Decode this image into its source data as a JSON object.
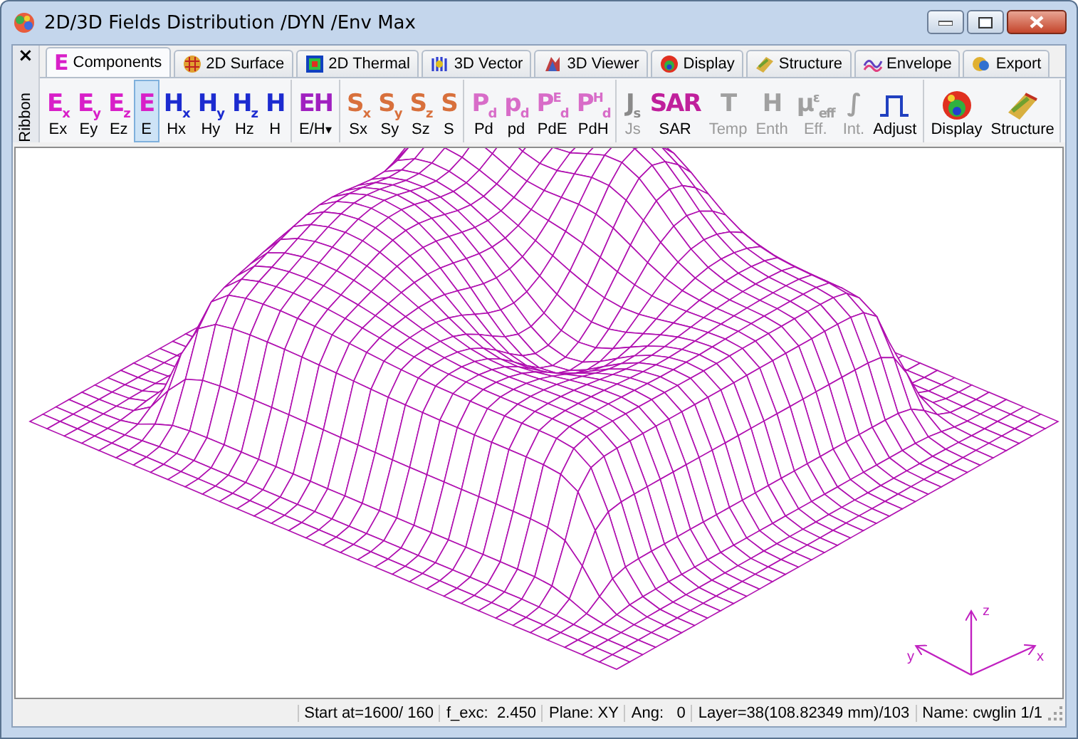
{
  "window": {
    "title": "2D/3D Fields Distribution /DYN /Env Max"
  },
  "ribbon_side": {
    "close": "×",
    "label": "Ribbon"
  },
  "tabs": [
    {
      "label": "Components",
      "glyph": "E",
      "kind": "glyph",
      "selected": true
    },
    {
      "label": "2D Surface",
      "kind": "surface",
      "selected": false
    },
    {
      "label": "2D Thermal",
      "kind": "thermal",
      "selected": false
    },
    {
      "label": "3D Vector",
      "kind": "vector",
      "selected": false
    },
    {
      "label": "3D Viewer",
      "kind": "viewer",
      "selected": false
    },
    {
      "label": "Display",
      "kind": "display",
      "selected": false
    },
    {
      "label": "Structure",
      "kind": "structure",
      "selected": false
    },
    {
      "label": "Envelope",
      "kind": "envelope",
      "selected": false
    },
    {
      "label": "Export",
      "kind": "export",
      "selected": false
    }
  ],
  "ribbon": {
    "groups": [
      [
        {
          "kind": "glyph",
          "glyph": "E$_{x}$",
          "label": "Ex",
          "color": "#d81fc8",
          "selected": false,
          "disabled": false
        },
        {
          "kind": "glyph",
          "glyph": "E$_{y}$",
          "label": "Ey",
          "color": "#d81fc8",
          "selected": false,
          "disabled": false
        },
        {
          "kind": "glyph",
          "glyph": "E$_{z}$",
          "label": "Ez",
          "color": "#d81fc8",
          "selected": false,
          "disabled": false
        },
        {
          "kind": "glyph",
          "glyph": "E",
          "label": "E",
          "color": "#d81fc8",
          "selected": true,
          "disabled": false
        },
        {
          "kind": "glyph",
          "glyph": "H$_{x}$",
          "label": "Hx",
          "color": "#1c2bd0",
          "selected": false,
          "disabled": false
        },
        {
          "kind": "glyph",
          "glyph": "H$_{y}$",
          "label": "Hy",
          "color": "#1c2bd0",
          "selected": false,
          "disabled": false
        },
        {
          "kind": "glyph",
          "glyph": "H$_{z}$",
          "label": "Hz",
          "color": "#1c2bd0",
          "selected": false,
          "disabled": false
        },
        {
          "kind": "glyph",
          "glyph": "H",
          "label": "H",
          "color": "#1c2bd0",
          "selected": false,
          "disabled": false
        }
      ],
      [
        {
          "kind": "dropdown",
          "glyph": "EH",
          "label": "E/H",
          "caret": "▾",
          "color": "#a020c0",
          "selected": false,
          "disabled": false
        }
      ],
      [
        {
          "kind": "glyph",
          "glyph": "S$_{x}$",
          "label": "Sx",
          "color": "#d8703c",
          "selected": false,
          "disabled": false
        },
        {
          "kind": "glyph",
          "glyph": "S$_{y}$",
          "label": "Sy",
          "color": "#d8703c",
          "selected": false,
          "disabled": false
        },
        {
          "kind": "glyph",
          "glyph": "S$_{z}$",
          "label": "Sz",
          "color": "#d8703c",
          "selected": false,
          "disabled": false
        },
        {
          "kind": "glyph",
          "glyph": "S",
          "label": "S",
          "color": "#d8703c",
          "selected": false,
          "disabled": false
        }
      ],
      [
        {
          "kind": "glyph",
          "glyph": "P$_{d}$",
          "label": "Pd",
          "color": "#d86cc8",
          "selected": false,
          "disabled": false
        },
        {
          "kind": "glyph",
          "glyph": "p$_{d}$",
          "label": "pd",
          "color": "#d86cc8",
          "selected": false,
          "disabled": false
        },
        {
          "kind": "glyph",
          "glyph": "P$^{E}$$_{d}$",
          "label": "PdE",
          "color": "#d86cc8",
          "selected": false,
          "disabled": false
        },
        {
          "kind": "glyph",
          "glyph": "P$^{H}$$_{d}$",
          "label": "PdH",
          "color": "#d86cc8",
          "selected": false,
          "disabled": false
        }
      ],
      [
        {
          "kind": "glyph",
          "glyph": "J$_{s}$",
          "label": "Js",
          "color": "#8a8a8a",
          "selected": false,
          "disabled": true
        },
        {
          "kind": "glyph",
          "glyph": "SAR",
          "label": "SAR",
          "color": "#c0209c",
          "selected": false,
          "disabled": false
        },
        {
          "kind": "glyph",
          "glyph": "T",
          "label": "Temp",
          "color": "#a0a0a0",
          "selected": false,
          "disabled": true
        },
        {
          "kind": "glyph",
          "glyph": "H",
          "label": "Enth",
          "color": "#a0a0a0",
          "selected": false,
          "disabled": true
        },
        {
          "kind": "glyph",
          "glyph": "μ$^{ε}$$_{eff}$",
          "label": "Eff.",
          "color": "#a0a0a0",
          "selected": false,
          "disabled": true
        },
        {
          "kind": "glyph",
          "glyph": "∫",
          "label": "Int.",
          "color": "#a0a0a0",
          "selected": false,
          "disabled": true
        },
        {
          "kind": "pulse",
          "label": "Adjust",
          "selected": false,
          "disabled": false
        }
      ],
      [
        {
          "kind": "display",
          "label": "Display",
          "selected": false,
          "disabled": false
        },
        {
          "kind": "structure",
          "label": "Structure",
          "selected": false,
          "disabled": false
        }
      ]
    ]
  },
  "plot": {
    "axes": {
      "x": "x",
      "y": "y",
      "z": "z"
    }
  },
  "status_bar": [
    "Start at=1600/ 160",
    "f_exc:  2.450",
    "Plane: XY",
    "Ang:   0",
    "Layer=38(108.82349 mm)/103",
    "Name: cwglin 1/1"
  ]
}
